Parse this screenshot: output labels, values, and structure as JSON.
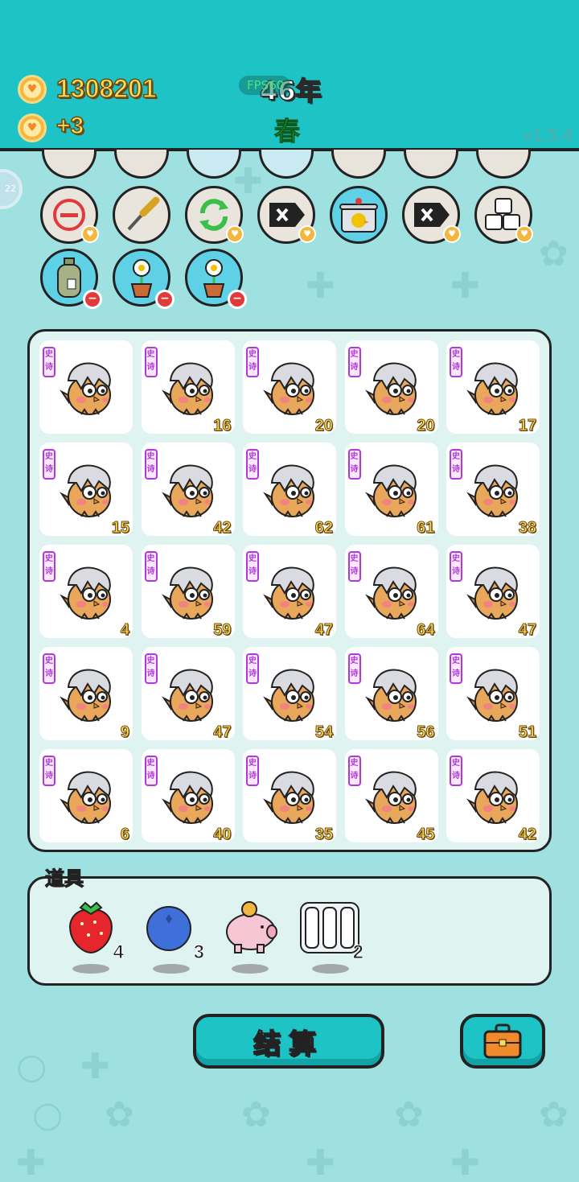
{
  "header": {
    "money": "1308201",
    "income": "+3",
    "year": "46年",
    "fps": "FPS60",
    "season": "春",
    "version": "v1.5.4",
    "side_badge": "22"
  },
  "relics": {
    "row1": [
      {
        "name": "minus-circle-icon",
        "color": "#e23a3a"
      },
      {
        "name": "screwdriver-icon",
        "color": "#d8a321"
      },
      {
        "name": "refresh-icon",
        "color": "#3bbf4a"
      },
      {
        "name": "delete-tag-icon",
        "color": "#222222"
      },
      {
        "name": "duck-pot-icon",
        "color": "#f0c200"
      },
      {
        "name": "delete-tag-icon",
        "color": "#222222"
      },
      {
        "name": "sugar-cubes-icon",
        "color": "#ffffff"
      }
    ],
    "row2": [
      {
        "name": "seed-bag-icon"
      },
      {
        "name": "flower-pot-icon"
      },
      {
        "name": "flower-pot-icon"
      }
    ]
  },
  "board": {
    "cell_tag": "史诗",
    "cells": [
      "",
      "16",
      "20",
      "20",
      "17",
      "15",
      "42",
      "62",
      "61",
      "38",
      "4",
      "59",
      "47",
      "64",
      "47",
      "9",
      "47",
      "54",
      "56",
      "51",
      "6",
      "40",
      "35",
      "45",
      "42"
    ]
  },
  "items": {
    "label": "道具",
    "list": [
      {
        "name": "strawberry-icon",
        "count": "4"
      },
      {
        "name": "blueberry-icon",
        "count": "3"
      },
      {
        "name": "piggy-bank-icon",
        "count": ""
      },
      {
        "name": "cage-icon",
        "count": "2"
      }
    ]
  },
  "actions": {
    "settle_label": "结算"
  },
  "colors": {
    "header": "#1ec3c6",
    "background": "#9fe0e0",
    "gold_text": "#ffdc54",
    "epic_tag": "#b03ad8"
  }
}
